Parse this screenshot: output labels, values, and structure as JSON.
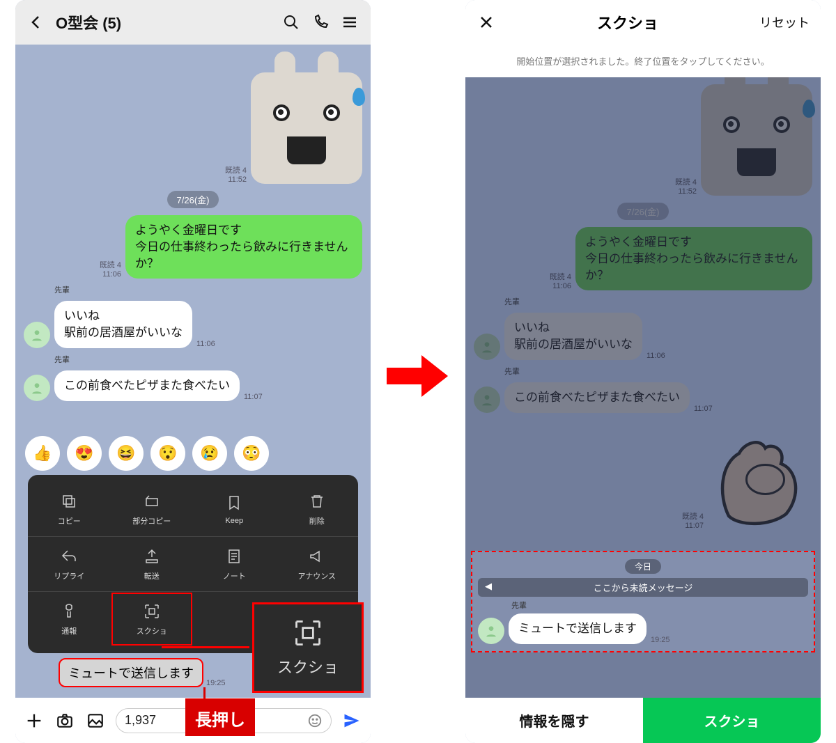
{
  "left": {
    "header": {
      "title": "O型会 (5)"
    },
    "sticker1_meta": {
      "read": "既読 4",
      "time": "11:52"
    },
    "date1": "7/26(金)",
    "msg1": {
      "text": "ようやく金曜日です\n今日の仕事終わったら飲みに行きませんか？",
      "read": "既読 4",
      "time": "11:06"
    },
    "sender": "先輩",
    "reply1": {
      "text": "いいね\n駅前の居酒屋がいいな",
      "time": "11:06"
    },
    "reply2": {
      "text": "この前食べたピザまた食べたい",
      "time": "11:07"
    },
    "ctx": [
      "コピー",
      "部分コピー",
      "Keep",
      "削除",
      "リプライ",
      "転送",
      "ノート",
      "アナウンス",
      "通報",
      "スクショ"
    ],
    "big_callout": "スクショ",
    "muted": {
      "text": "ミュートで送信します",
      "time": "19:25"
    },
    "input_value": "1,937",
    "longpress": "長押し"
  },
  "right": {
    "header": {
      "title": "スクショ",
      "reset": "リセット"
    },
    "prompt": "開始位置が選択されました。終了位置をタップしてください。",
    "sticker1_meta": {
      "read": "既読 4",
      "time": "11:52"
    },
    "date1": "7/26(金)",
    "msg1": {
      "text": "ようやく金曜日です\n今日の仕事終わったら飲みに行きませんか？",
      "read": "既読 4",
      "time": "11:06"
    },
    "sender": "先輩",
    "reply1": {
      "text": "いいね\n駅前の居酒屋がいいな",
      "time": "11:06"
    },
    "reply2": {
      "text": "この前食べたピザまた食べたい",
      "time": "11:07"
    },
    "sticker2_meta": {
      "read": "既読 4",
      "time": "11:07"
    },
    "sel": {
      "today": "今日",
      "unread": "ここから未読メッセージ",
      "sender": "先輩",
      "msg": "ミュートで送信します",
      "time": "19:25"
    },
    "actions": {
      "hide": "情報を隠す",
      "shot": "スクショ"
    }
  }
}
